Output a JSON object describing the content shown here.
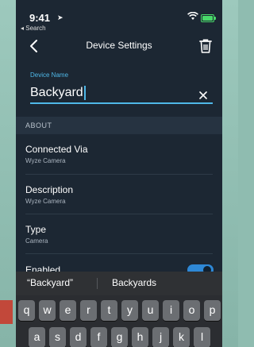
{
  "status_bar": {
    "time": "9:41",
    "location_arrow": "➤",
    "back_label": "◂ Search"
  },
  "nav": {
    "title": "Device Settings"
  },
  "device_name": {
    "label": "Device Name",
    "value": "Backyard"
  },
  "section": {
    "title": "ABOUT"
  },
  "rows": [
    {
      "title": "Connected Via",
      "subtitle": "Wyze Camera"
    },
    {
      "title": "Description",
      "subtitle": "Wyze Camera"
    },
    {
      "title": "Type",
      "subtitle": "Camera"
    },
    {
      "title": "Enabled"
    }
  ],
  "enabled_toggle": {
    "state": "on"
  },
  "predictions": [
    "“Backyard”",
    "Backyards"
  ],
  "keyboard": {
    "row1": [
      "q",
      "w",
      "e",
      "r",
      "t",
      "y",
      "u",
      "i",
      "o",
      "p"
    ],
    "row2": [
      "a",
      "s",
      "d",
      "f",
      "g",
      "h",
      "j",
      "k",
      "l"
    ]
  },
  "colors": {
    "background": "#1c2733",
    "accent": "#4fb8e8",
    "toggle": "#2e88d6"
  }
}
